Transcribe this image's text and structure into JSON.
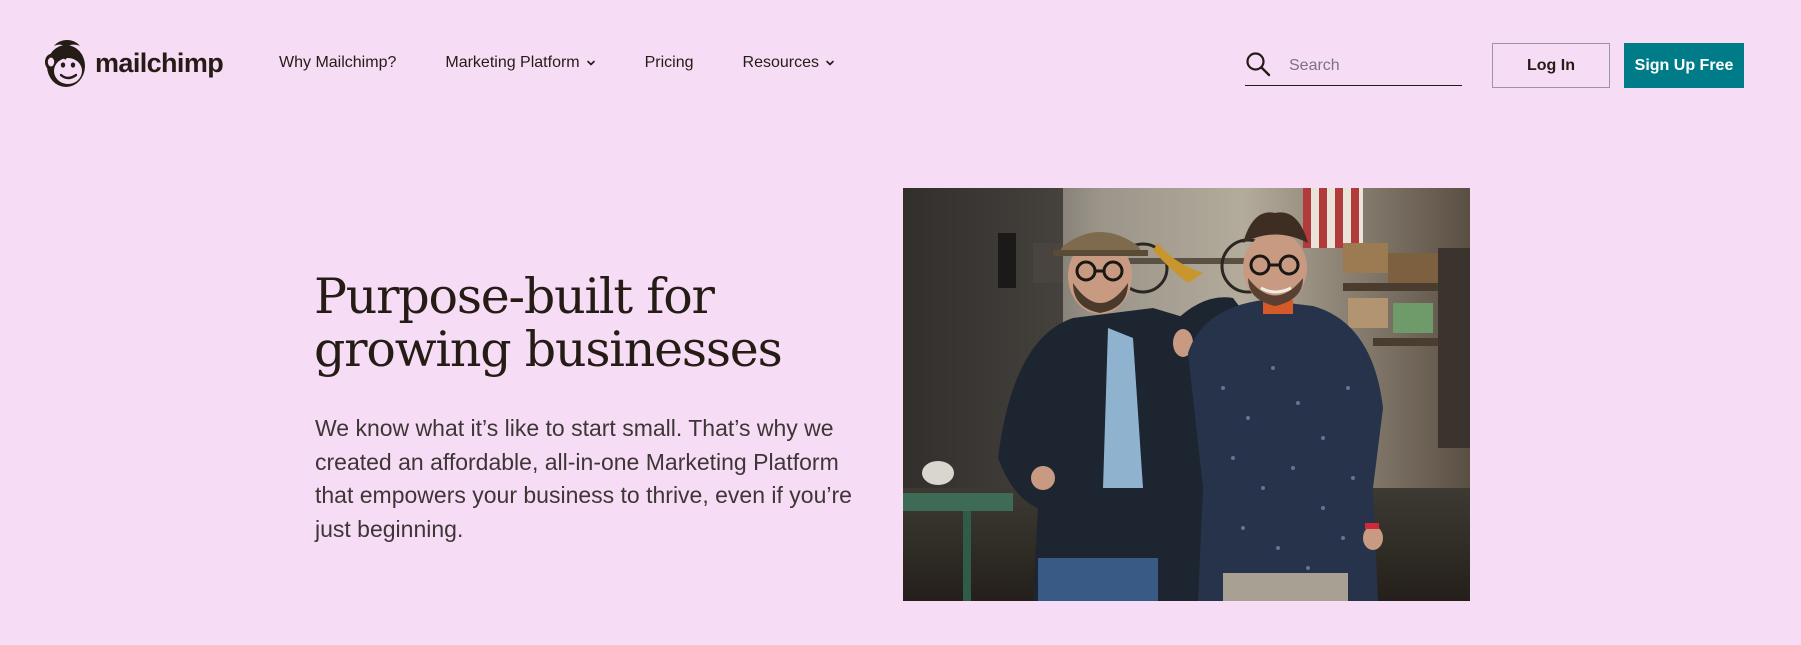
{
  "brand": {
    "name": "mailchimp",
    "accent_color": "#007c89",
    "background_color": "#f7dcf6"
  },
  "nav": {
    "items": [
      {
        "label": "Why Mailchimp?",
        "has_dropdown": false
      },
      {
        "label": "Marketing Platform",
        "has_dropdown": true
      },
      {
        "label": "Pricing",
        "has_dropdown": false
      },
      {
        "label": "Resources",
        "has_dropdown": true
      }
    ]
  },
  "search": {
    "placeholder": "Search",
    "value": "",
    "icon": "search-icon"
  },
  "header_actions": {
    "login_label": "Log In",
    "signup_label": "Sign Up Free"
  },
  "hero": {
    "title_line1": "Purpose-built for",
    "title_line2": "growing businesses",
    "description": "We know what it’s like to start small. That’s why we created an affordable, all-in-one Marketing Platform that empowers your business to thrive, even if you’re just beginning."
  }
}
